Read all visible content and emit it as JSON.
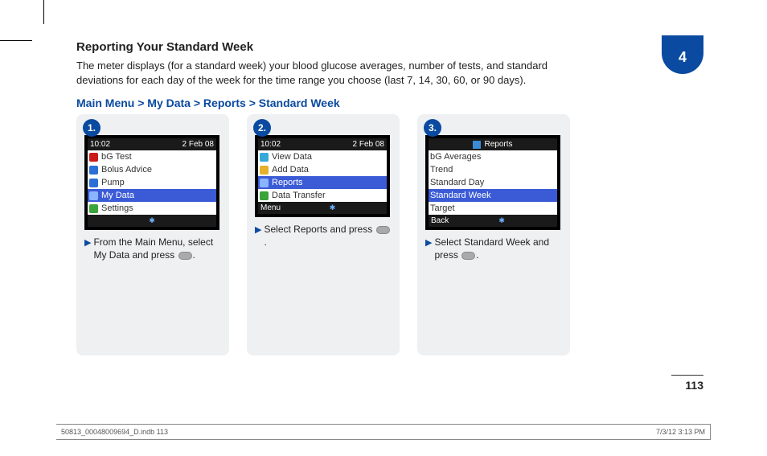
{
  "chapter": "4",
  "heading": "Reporting Your Standard Week",
  "intro": "The meter displays (for a standard week) your blood glucose averages, number of tests, and standard deviations for each day of the week for the time range you choose (last 7, 14, 30, 60, or 90 days).",
  "breadcrumb": "Main Menu > My Data > Reports > Standard Week",
  "steps": [
    {
      "num": "1.",
      "caption_pre": "From the Main Menu, select My Data and press ",
      "caption_post": ".",
      "screen": {
        "topLeft": "10:02",
        "topRight": "2 Feb 08",
        "titleBar": null,
        "items": [
          {
            "label": "bG Test",
            "iconColor": "#cc1a1a",
            "selected": false
          },
          {
            "label": "Bolus Advice",
            "iconColor": "#2b6fd6",
            "selected": false
          },
          {
            "label": "Pump",
            "iconColor": "#2b6fd6",
            "selected": false
          },
          {
            "label": "My Data",
            "iconColor": "#8bb4ff",
            "selected": true
          },
          {
            "label": "Settings",
            "iconColor": "#3aa33a",
            "selected": false
          }
        ],
        "footLeft": "",
        "footRight": ""
      }
    },
    {
      "num": "2.",
      "caption_pre": "Select Reports and press ",
      "caption_post": ".",
      "screen": {
        "topLeft": "10:02",
        "topRight": "2 Feb 08",
        "titleBar": null,
        "items": [
          {
            "label": "View Data",
            "iconColor": "#37a9d9",
            "selected": false
          },
          {
            "label": "Add Data",
            "iconColor": "#e4b12a",
            "selected": false
          },
          {
            "label": "Reports",
            "iconColor": "#8bb4ff",
            "selected": true
          },
          {
            "label": "Data Transfer",
            "iconColor": "#3aa33a",
            "selected": false
          }
        ],
        "footLeft": "Menu",
        "footRight": ""
      }
    },
    {
      "num": "3.",
      "caption_pre": "Select Standard Week and press ",
      "caption_post": ".",
      "screen": {
        "topLeft": null,
        "topRight": null,
        "titleBar": "Reports",
        "items": [
          {
            "label": "bG Averages",
            "iconColor": null,
            "selected": false
          },
          {
            "label": "Trend",
            "iconColor": null,
            "selected": false
          },
          {
            "label": "Standard Day",
            "iconColor": null,
            "selected": false
          },
          {
            "label": "Standard Week",
            "iconColor": null,
            "selected": true
          },
          {
            "label": "Target",
            "iconColor": null,
            "selected": false
          }
        ],
        "footLeft": "Back",
        "footRight": ""
      }
    }
  ],
  "pageNumber": "113",
  "footerLeft": "50813_00048009694_D.indb   113",
  "footerRight": "7/3/12   3:13 PM"
}
